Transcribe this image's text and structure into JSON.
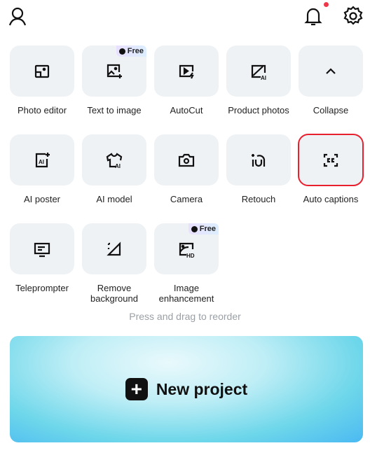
{
  "header": {
    "notification_dot_color": "#f0374a"
  },
  "tiles": [
    {
      "label": "Photo editor",
      "icon": "photo-editor-icon"
    },
    {
      "label": "Text to image",
      "icon": "image-sparkle-icon",
      "badge": "Free"
    },
    {
      "label": "AutoCut",
      "icon": "autocut-icon"
    },
    {
      "label": "Product photos",
      "icon": "product-photo-ai-icon"
    },
    {
      "label": "Collapse",
      "icon": "chevron-up-icon"
    },
    {
      "label": "AI poster",
      "icon": "ai-poster-icon"
    },
    {
      "label": "AI model",
      "icon": "ai-shirt-icon"
    },
    {
      "label": "Camera",
      "icon": "camera-icon"
    },
    {
      "label": "Retouch",
      "icon": "retouch-icon"
    },
    {
      "label": "Auto captions",
      "icon": "captions-icon",
      "selected": true
    },
    {
      "label": "Teleprompter",
      "icon": "teleprompter-icon"
    },
    {
      "label": "Remove background",
      "icon": "remove-background-icon"
    },
    {
      "label": "Image enhancement",
      "icon": "image-hd-icon",
      "badge": "Free"
    }
  ],
  "hint": "Press and drag to reorder",
  "new_project": {
    "label": "New project"
  }
}
